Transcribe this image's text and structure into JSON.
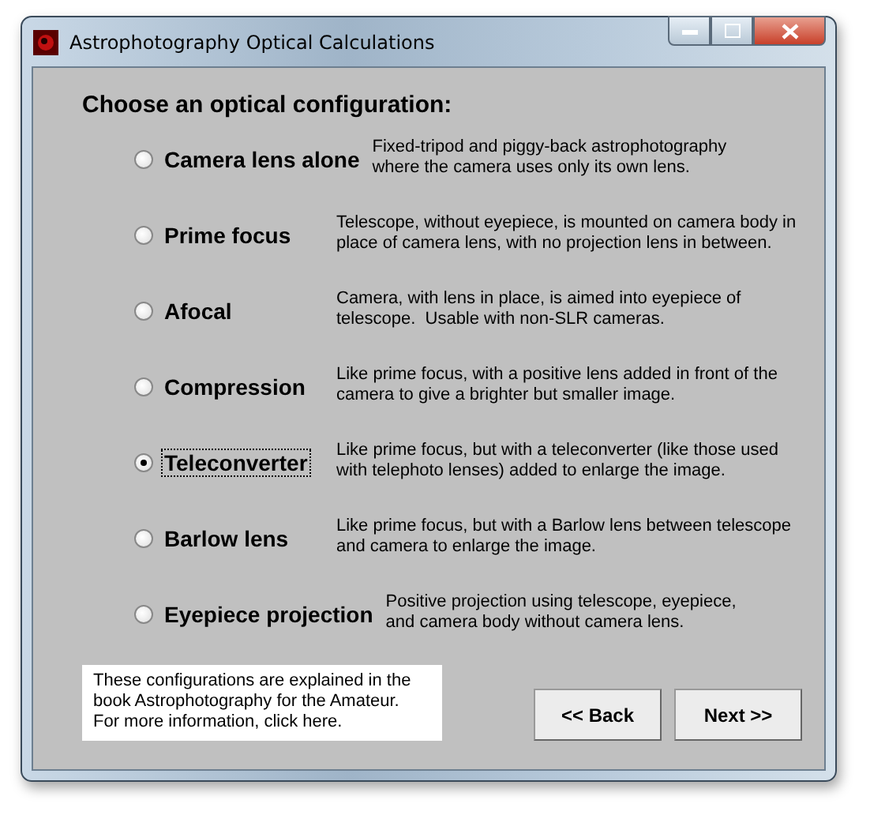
{
  "window": {
    "title": "Astrophotography Optical Calculations"
  },
  "heading": "Choose an optical configuration:",
  "options": [
    {
      "label": "Camera lens alone",
      "description": "Fixed-tripod and piggy-back astrophotography\nwhere the camera uses only its own lens.",
      "selected": false
    },
    {
      "label": "Prime focus",
      "description": "Telescope, without eyepiece, is mounted on camera body in\nplace of camera lens, with no projection lens in between.",
      "selected": false
    },
    {
      "label": "Afocal",
      "description": "Camera, with lens in place, is aimed into eyepiece of\ntelescope.  Usable with non-SLR cameras.",
      "selected": false
    },
    {
      "label": "Compression",
      "description": "Like prime focus, with a positive lens added in front of the\ncamera to give a brighter but smaller image.",
      "selected": false
    },
    {
      "label": "Teleconverter",
      "description": "Like prime focus, but with a teleconverter (like those used\nwith telephoto lenses) added to enlarge the image.",
      "selected": true
    },
    {
      "label": "Barlow lens",
      "description": "Like prime focus, but with a Barlow lens between telescope\nand camera to enlarge the image.",
      "selected": false
    },
    {
      "label": "Eyepiece projection",
      "description": "Positive projection using telescope, eyepiece,\nand camera body without camera lens.",
      "selected": false
    }
  ],
  "info": "These configurations are explained in the\nbook Astrophotography for the Amateur.\nFor more information, click here.",
  "buttons": [
    "<< Back",
    "Next >>"
  ]
}
